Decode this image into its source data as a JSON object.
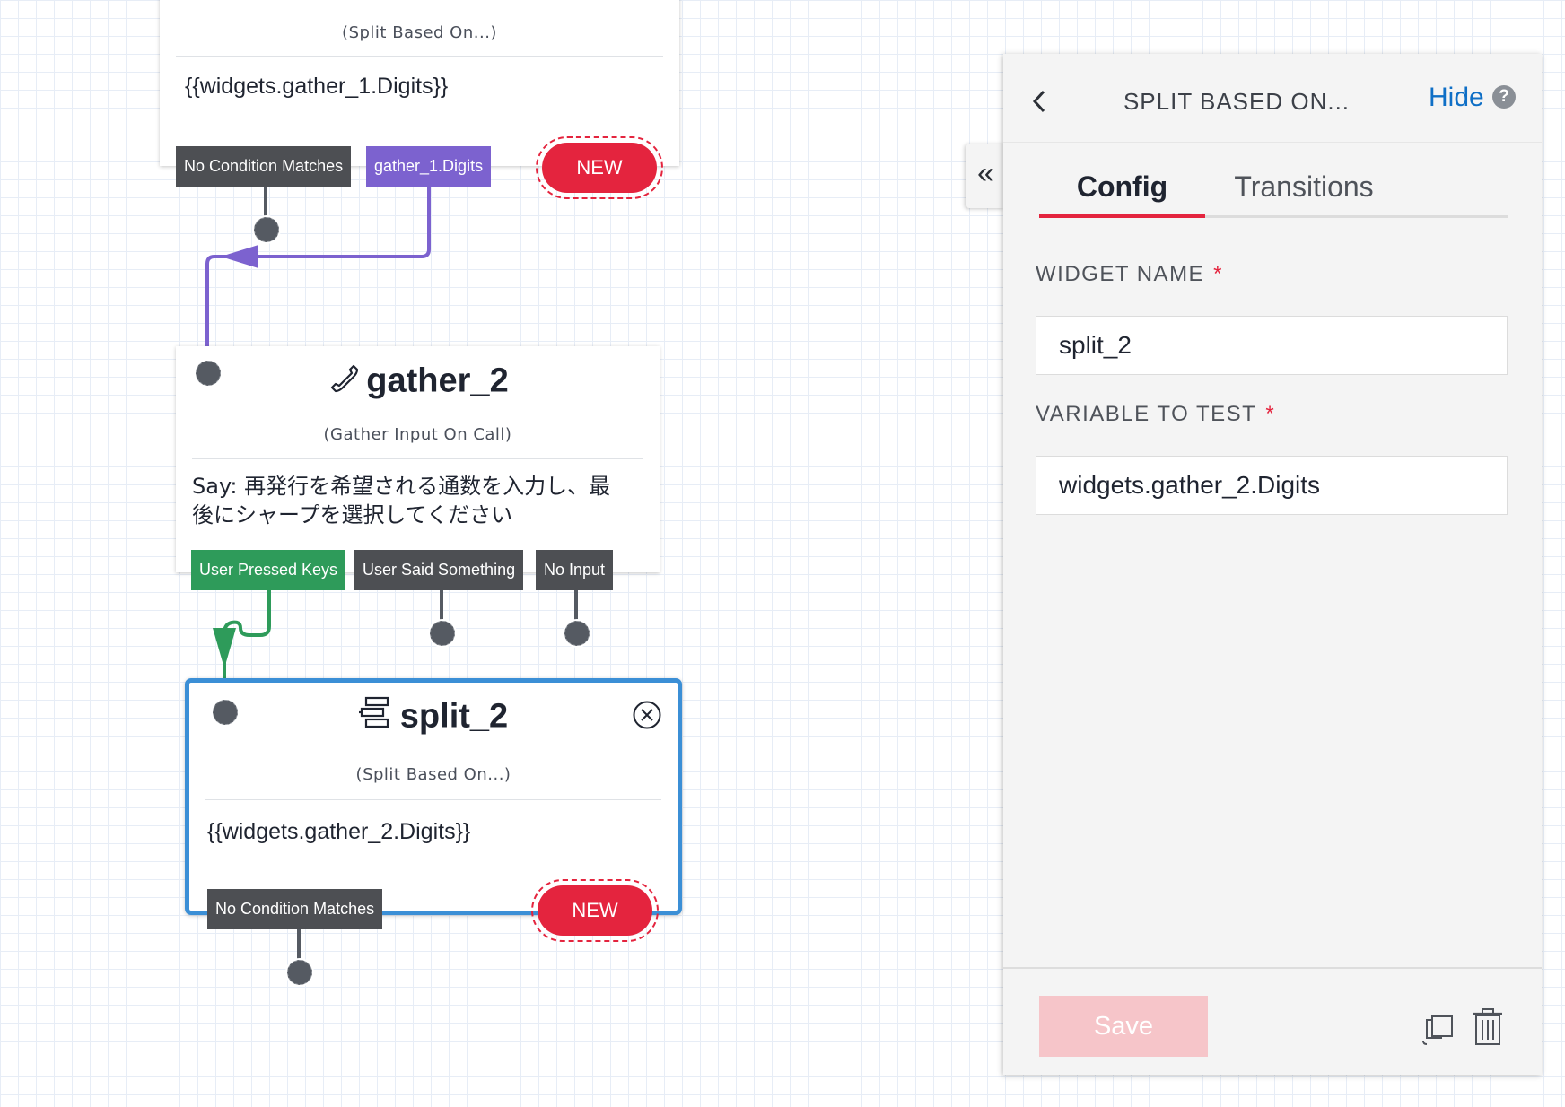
{
  "canvas": {
    "top_widget": {
      "subtitle": "(Split Based On...)",
      "body": "{{widgets.gather_1.Digits}}",
      "transitions": [
        "No Condition Matches",
        "gather_1.Digits"
      ],
      "new_label": "NEW"
    },
    "gather_widget": {
      "title": "gather_2",
      "icon": "phone-icon",
      "subtitle": "(Gather Input On Call)",
      "body": "Say: 再発行を希望される通数を入力し、最後にシャープを選択してください",
      "transitions": [
        "User Pressed Keys",
        "User Said Something",
        "No Input"
      ]
    },
    "split_widget": {
      "title": "split_2",
      "icon": "split-icon",
      "subtitle": "(Split Based On...)",
      "body": "{{widgets.gather_2.Digits}}",
      "transitions": [
        "No Condition Matches"
      ],
      "new_label": "NEW"
    }
  },
  "panel": {
    "title": "SPLIT BASED ON...",
    "hide_label": "Hide",
    "tabs": [
      {
        "label": "Config",
        "active": true
      },
      {
        "label": "Transitions",
        "active": false
      }
    ],
    "fields": {
      "widget_name": {
        "label": "WIDGET NAME",
        "required_mark": "*",
        "value": "split_2"
      },
      "variable_to_test": {
        "label": "VARIABLE TO TEST",
        "required_mark": "*",
        "value": "widgets.gather_2.Digits"
      }
    },
    "save_label": "Save"
  },
  "colors": {
    "accent_red": "#e4243e",
    "purple": "#7c62cf",
    "green": "#2e9b5a",
    "selected_blue": "#3b8fd6",
    "link_blue": "#0f6fc6"
  }
}
